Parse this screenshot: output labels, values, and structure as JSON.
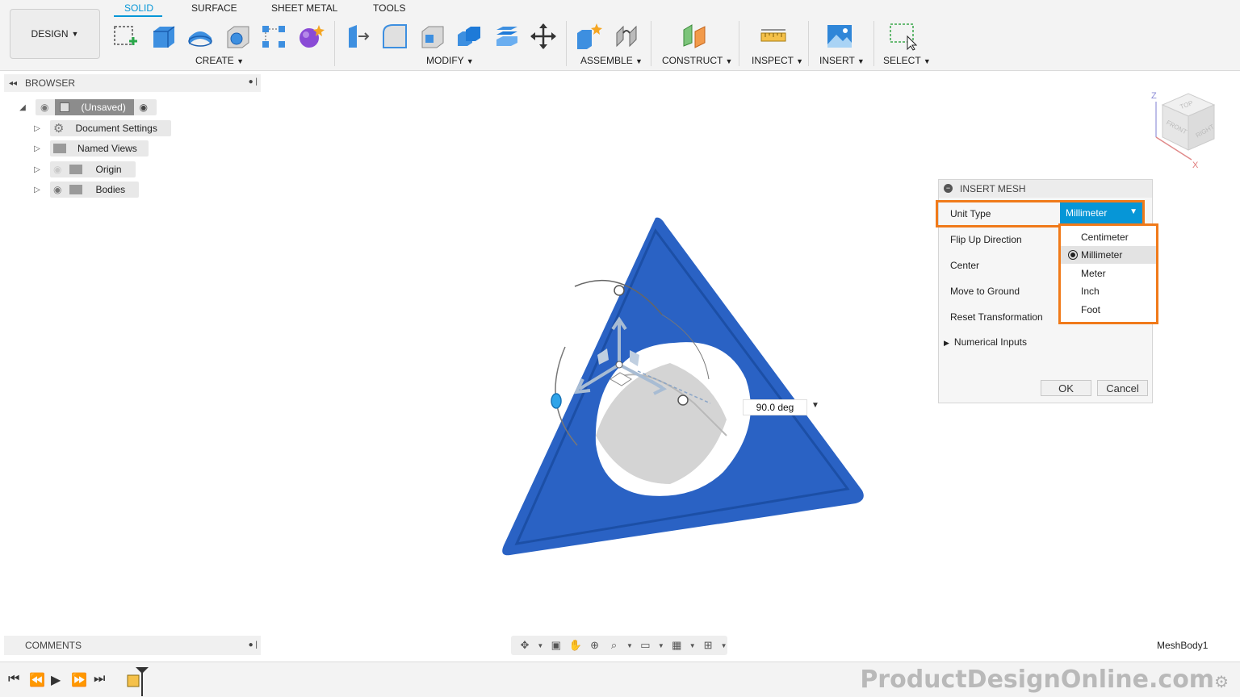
{
  "workspace": {
    "label": "DESIGN"
  },
  "tabs": [
    {
      "label": "SOLID",
      "active": true
    },
    {
      "label": "SURFACE",
      "active": false
    },
    {
      "label": "SHEET METAL",
      "active": false
    },
    {
      "label": "TOOLS",
      "active": false
    }
  ],
  "groups": {
    "create": "CREATE",
    "modify": "MODIFY",
    "assemble": "ASSEMBLE",
    "construct": "CONSTRUCT",
    "inspect": "INSPECT",
    "insert": "INSERT",
    "select": "SELECT"
  },
  "browser": {
    "title": "BROWSER",
    "root": "(Unsaved)",
    "items": [
      {
        "label": "Document Settings",
        "icon": "gear-icon"
      },
      {
        "label": "Named Views",
        "icon": "folder-icon"
      },
      {
        "label": "Origin",
        "icon": "folder-icon"
      },
      {
        "label": "Bodies",
        "icon": "folder-icon"
      }
    ]
  },
  "comments": {
    "title": "COMMENTS"
  },
  "viewport": {
    "angle_value": "90.0 deg",
    "body_name": "MeshBody1"
  },
  "viewcube": {
    "top": "TOP",
    "front": "FRONT",
    "right": "RIGHT",
    "axis_z": "Z",
    "axis_x": "X"
  },
  "dialog": {
    "title": "INSERT MESH",
    "unit_type_label": "Unit Type",
    "unit_type_value": "Millimeter",
    "flip_up_label": "Flip Up Direction",
    "center_label": "Center",
    "move_ground_label": "Move to Ground",
    "reset_label": "Reset Transformation",
    "numerical_inputs_label": "Numerical Inputs",
    "ok_label": "OK",
    "cancel_label": "Cancel"
  },
  "unit_options": [
    {
      "label": "Centimeter",
      "selected": false
    },
    {
      "label": "Millimeter",
      "selected": true
    },
    {
      "label": "Meter",
      "selected": false
    },
    {
      "label": "Inch",
      "selected": false
    },
    {
      "label": "Foot",
      "selected": false
    }
  ],
  "watermark": "ProductDesignOnline.com",
  "colors": {
    "accent": "#0696d7",
    "highlight": "#f07a1a",
    "mesh": "#2a62c4"
  }
}
